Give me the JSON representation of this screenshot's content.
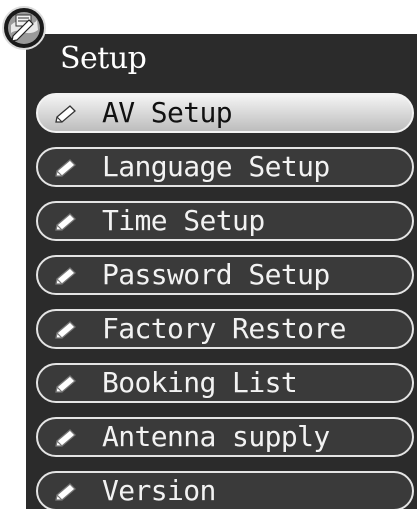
{
  "header": {
    "title": "Setup",
    "logo_icon": "setup-globe-icon"
  },
  "menu": {
    "selected_index": 0,
    "items": [
      {
        "label": "AV Setup",
        "icon": "pencil-icon"
      },
      {
        "label": "Language Setup",
        "icon": "pencil-icon"
      },
      {
        "label": "Time Setup",
        "icon": "pencil-icon"
      },
      {
        "label": "Password Setup",
        "icon": "pencil-icon"
      },
      {
        "label": "Factory Restore",
        "icon": "pencil-icon"
      },
      {
        "label": "Booking List",
        "icon": "pencil-icon"
      },
      {
        "label": "Antenna supply",
        "icon": "pencil-icon"
      },
      {
        "label": "Version",
        "icon": "pencil-icon"
      }
    ]
  },
  "colors": {
    "panel_background": "#2b2b2b",
    "item_background": "#3a3a3a",
    "item_border": "#e4e4e4",
    "selected_background": "#dcdcdc",
    "selected_text": "#111111",
    "item_text": "#f2f2f2"
  }
}
